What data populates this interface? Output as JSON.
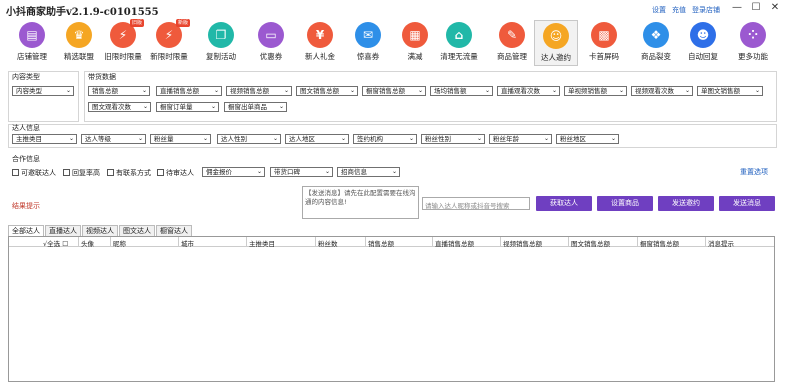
{
  "app": {
    "title": "小抖商家助手v2.1.9-c0101555",
    "links": [
      "设置",
      "充值",
      "登录店铺"
    ],
    "window_controls": [
      "—",
      "☐",
      "✕"
    ]
  },
  "toolbar": [
    {
      "label": "店铺管理",
      "icon": "shop-icon",
      "color": "#9b59d0",
      "glyph": "▤"
    },
    {
      "label": "精选联盟",
      "icon": "crown-icon",
      "color": "#f5a623",
      "glyph": "♛"
    },
    {
      "label": "旧限时限量",
      "icon": "flash-icon",
      "color": "#ef5a3c",
      "glyph": "⚡",
      "badge": "旧版"
    },
    {
      "label": "新限时限量",
      "icon": "flash-new-icon",
      "color": "#ef5a3c",
      "glyph": "⚡",
      "badge": "新版"
    },
    {
      "label": "复制活动",
      "icon": "copy-icon",
      "color": "#21b8a8",
      "glyph": "❐"
    },
    {
      "label": "优惠券",
      "icon": "coupon-icon",
      "color": "#9b59d0",
      "glyph": "▭"
    },
    {
      "label": "新人礼金",
      "icon": "gift-money-icon",
      "color": "#ef5a3c",
      "glyph": "¥"
    },
    {
      "label": "惊喜券",
      "icon": "surprise-coupon-icon",
      "color": "#2e8fe8",
      "glyph": "✉"
    },
    {
      "label": "满减",
      "icon": "discount-icon",
      "color": "#ef5a3c",
      "glyph": "▦"
    },
    {
      "label": "清理无流量",
      "icon": "clean-icon",
      "color": "#21b8a8",
      "glyph": "⌂"
    },
    {
      "label": "商品管理",
      "icon": "product-icon",
      "color": "#ef5a3c",
      "glyph": "✎"
    },
    {
      "label": "达人邀约",
      "icon": "influencer-invite-icon",
      "color": "#f5a623",
      "glyph": "☺",
      "active": true
    },
    {
      "label": "卡首屏码",
      "icon": "qrcode-icon",
      "color": "#ef5a3c",
      "glyph": "▩"
    },
    {
      "label": "商品裂变",
      "icon": "split-icon",
      "color": "#2e8fe8",
      "glyph": "❖"
    },
    {
      "label": "自动回复",
      "icon": "robot-icon",
      "color": "#2e6fe8",
      "glyph": "☻"
    },
    {
      "label": "更多功能",
      "icon": "more-icon",
      "color": "#9b59d0",
      "glyph": "⁘"
    }
  ],
  "content_type": {
    "title": "内容类型",
    "value": "内容类型"
  },
  "goods_data": {
    "title": "带货数据",
    "row1": [
      "销售总额",
      "直播销售总额",
      "视频销售总额",
      "图文销售总额",
      "橱窗销售总额",
      "场均销售额",
      "直播观看次数",
      "单视频销售额",
      "视频观看次数",
      "单图文销售额"
    ],
    "row2": [
      "图文观看次数",
      "橱窗订单量",
      "橱窗出单商品"
    ]
  },
  "influencer_info": {
    "title": "达人信息",
    "filters": [
      "主推类目",
      "达人等级",
      "粉丝量",
      "达人性别",
      "达人地区",
      "签约机构",
      "粉丝性别",
      "粉丝年龄",
      "粉丝地区"
    ]
  },
  "cooperation": {
    "title": "合作信息",
    "checks": [
      "可邀联达人",
      "回复率高",
      "有联系方式",
      "待审达人"
    ],
    "filters": [
      "佣金报价",
      "带货口碑",
      "招商信息"
    ],
    "reset": "重置选项"
  },
  "result_hint": "结果提示",
  "message_placeholder": "【发送消息】请先在此配置需要在线沟通的内容信息!",
  "search_placeholder": "请输入达人昵称或抖音号搜索",
  "buttons": [
    "获取达人",
    "设置商品",
    "发送邀约",
    "发送消息"
  ],
  "tabs": [
    "全部达人",
    "直播达人",
    "视频达人",
    "图文达人",
    "橱窗达人"
  ],
  "table": {
    "check_all": "√全选",
    "columns": [
      "头像",
      "昵称",
      "城市",
      "主推类目",
      "粉丝数",
      "销售总额",
      "直播销售总额",
      "视频销售总额",
      "图文销售总额",
      "橱窗销售总额",
      "消息提示"
    ]
  }
}
